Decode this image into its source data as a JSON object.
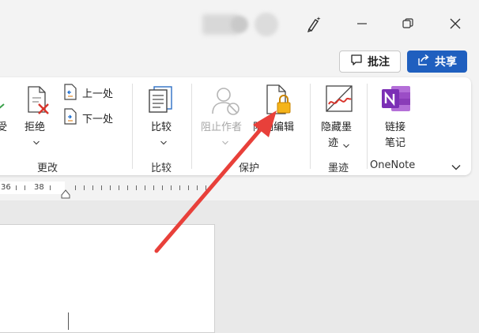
{
  "titlebar": {
    "icons": [
      "avatar-blurred",
      "pen-sparkle-icon",
      "minimize-icon",
      "restore-icon",
      "close-icon"
    ]
  },
  "actions": {
    "comment_label": "批注",
    "share_label": "共享"
  },
  "ribbon": {
    "changes_group": {
      "partial_label": "受",
      "reject_label": "拒绝",
      "previous_label": "上一处",
      "next_label": "下一处",
      "group_label": "更改"
    },
    "compare_group": {
      "compare_label": "比较",
      "group_label": "比较"
    },
    "protect_group": {
      "block_authors_label": "阻止作者",
      "restrict_editing_label": "限制编辑",
      "group_label": "保护"
    },
    "ink_group": {
      "hide_ink_line1": "隐藏墨",
      "hide_ink_line2": "迹",
      "group_label": "墨迹"
    },
    "onenote_group": {
      "linked_notes_line1": "链接",
      "linked_notes_line2": "笔记",
      "group_label": "OneNote"
    }
  },
  "ruler": {
    "marks": [
      "36",
      "38"
    ]
  },
  "colors": {
    "accent": "#1f5fbf",
    "arrow": "#e8403a",
    "onenote": "#7b2fb5",
    "lock": "#f0a30a"
  }
}
